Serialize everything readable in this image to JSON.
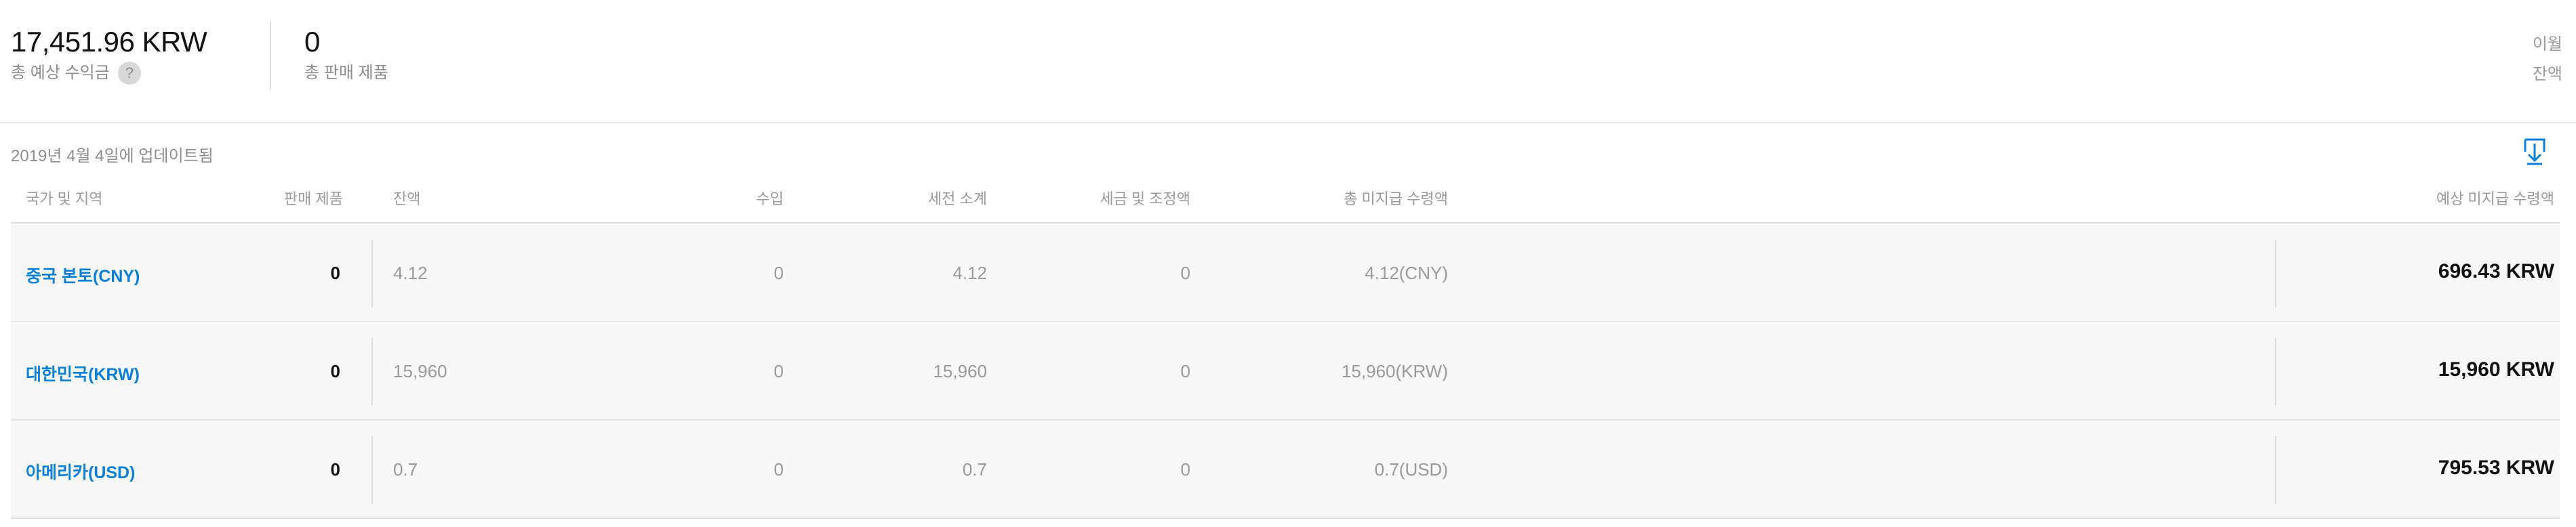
{
  "summary": {
    "estimated_earnings_value": "17,451.96 KRW",
    "estimated_earnings_label": "총 예상 수익금",
    "help_symbol": "?",
    "units_sold_value": "0",
    "units_sold_label": "총 판매 제품",
    "links": [
      "이월",
      "잔액"
    ]
  },
  "updated_text": "2019년 4월 4일에 업데이트됨",
  "table": {
    "headers": {
      "country": "국가 및 지역",
      "units": "판매 제품",
      "balance": "잔액",
      "income": "수입",
      "pretax": "세전 소계",
      "tax": "세금 및 조정액",
      "total_unpaid": "총 미지급 수령액",
      "estimated_unpaid": "예상 미지급 수령액"
    },
    "rows": [
      {
        "country": "중국 본토(CNY)",
        "units": "0",
        "balance": "4.12",
        "income": "0",
        "pretax": "4.12",
        "tax": "0",
        "total_unpaid": "4.12(CNY)",
        "estimated": "696.43 KRW"
      },
      {
        "country": "대한민국(KRW)",
        "units": "0",
        "balance": "15,960",
        "income": "0",
        "pretax": "15,960",
        "tax": "0",
        "total_unpaid": "15,960(KRW)",
        "estimated": "15,960 KRW"
      },
      {
        "country": "아메리카(USD)",
        "units": "0",
        "balance": "0.7",
        "income": "0",
        "pretax": "0.7",
        "tax": "0",
        "total_unpaid": "0.7(USD)",
        "estimated": "795.53 KRW"
      }
    ]
  },
  "icons": {
    "download": "download-icon",
    "help": "help-icon"
  },
  "colors": {
    "link": "#0a7fd8",
    "row_bg": "#f7f7f7",
    "muted": "#9a9a9a"
  }
}
